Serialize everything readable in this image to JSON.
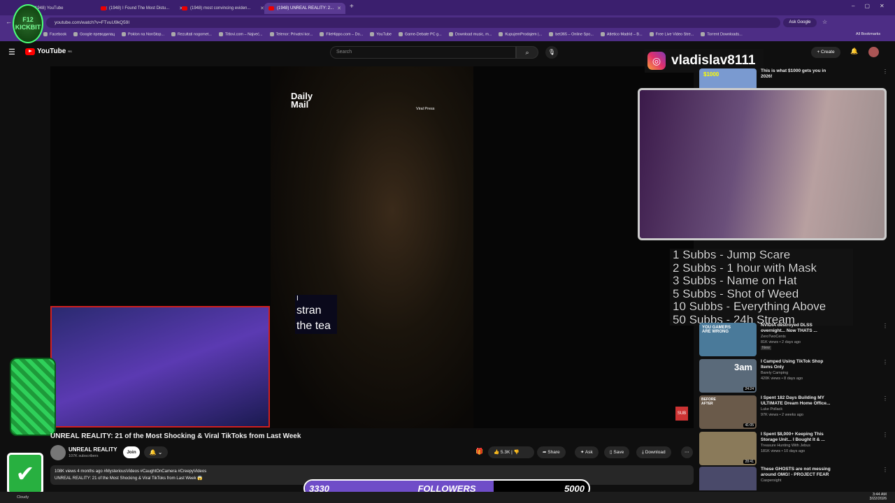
{
  "browser": {
    "tabs": [
      {
        "label": "(1948) YouTube",
        "active": false
      },
      {
        "label": "(1948) I Found The Most Distu...",
        "active": false
      },
      {
        "label": "(1948) most convincing eviden...",
        "active": false
      },
      {
        "label": "(1948) UNREAL REALITY: 2...",
        "active": true
      }
    ],
    "url": "youtube.com/watch?v=FTvuU9kQ59I",
    "ask_google": "Ask Google",
    "bookmarks": [
      "Facebook",
      "Google преводилац",
      "Poklon na NonStop...",
      "Rezultati nogomet...",
      "Titlovi.com – Najveć...",
      "Telenor: Privatni kor...",
      "FileHippo.com – Do...",
      "YouTube",
      "Game-Debate PC g...",
      "Download music, m...",
      "KupujemProdajem |...",
      "bet365 – Online Spo...",
      "Atletico Madrid – B...",
      "Free Live Video Stre...",
      "Torrent Downloads..."
    ],
    "all_bookmarks": "All Bookmarks"
  },
  "youtube": {
    "logo": "YouTube",
    "country": "RS",
    "search_placeholder": "Search",
    "create_label": "Create",
    "notifications": "9+"
  },
  "video": {
    "watermark": "Daily Mail",
    "credit": "Viral Press",
    "caption_lines": [
      "I",
      "stran",
      "the tea"
    ],
    "title": "UNREAL REALITY: 21 of the Most Shocking & Viral TikToks from Last Week",
    "channel": "UNREAL REALITY",
    "subscribers": "107K subscribers",
    "join": "Join",
    "likes": "5.3K",
    "share": "Share",
    "ask": "Ask",
    "save": "Save",
    "download": "Download",
    "stats": "108K views  4 months ago  #MysteriousVideos #CaughtOnCamera #CreepyVideos",
    "desc_line": "UNREAL REALITY: 21 of the Most Shocking & Viral TikToks from Last Week 😱"
  },
  "stream_overlay": {
    "instagram_handle": "vladislav8111",
    "sub_goals": [
      "1 Subbs - Jump Scare",
      "2 Subbs - 1 hour with Mask",
      "3 Subbs - Name on Hat",
      "5 Subbs - Shot of Weed",
      "10 Subbs - Everything Above",
      "50 Subbs - 24h Stream"
    ],
    "followers_current": "3330",
    "followers_label": "FOLLOWERS",
    "followers_goal": "5000",
    "followers_progress": 0.666,
    "logo_text": "F12 KICKBIT"
  },
  "sidebar": {
    "top_item": {
      "title": "This is what $1000 gets you in 2026!",
      "thumb": "$1000"
    },
    "items": [
      {
        "title": "NVIDIA destroyed DLSS overnight... Now THATS ...",
        "channel": "ZeroTwoCents",
        "meta": "81K views • 2 days ago",
        "badge": "New",
        "thumb": "YOU GAMERS ARE WRONG"
      },
      {
        "title": "I Camped Using TikTok Shop Items Only",
        "channel": "Barely Camping",
        "meta": "420K views • 8 days ago",
        "duration": "24:24",
        "thumb": "3am"
      },
      {
        "title": "I Spent 182 Days Building MY ULTIMATE Dream Home Office...",
        "channel": "Luke Pollack",
        "meta": "97K views • 2 weeks ago",
        "duration": "41:05",
        "thumb": "BEFORE AFTER"
      },
      {
        "title": "I Spent $8,000+ Keeping This Storage Unit... I Bought It & ...",
        "channel": "Treasure Hunting With Jebus",
        "meta": "181K views • 10 days ago",
        "duration": "28:41"
      },
      {
        "title": "These GHOSTS are not messing around OMG! - PROJECT FEAR",
        "channel": "Caspersight",
        "meta": ""
      }
    ]
  },
  "taskbar": {
    "weather": "Cloudy",
    "time": "3:44 AM",
    "date": "3/22/2026"
  }
}
